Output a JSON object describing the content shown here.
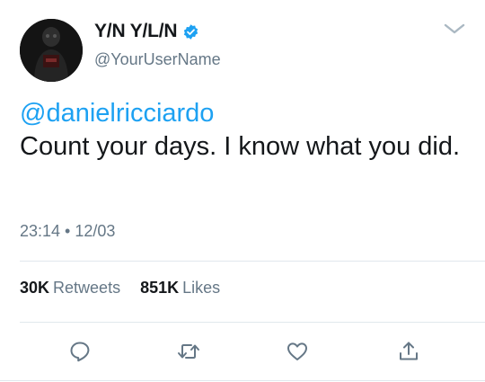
{
  "author": {
    "display_name": "Y/N Y/L/N",
    "username": "@YourUserName",
    "verified": true
  },
  "tweet": {
    "mention": "@danielricciardo",
    "text": "Count your days. I know what you did.",
    "timestamp": "23:14 • 12/03"
  },
  "stats": {
    "retweets_count": "30K",
    "retweets_label": "Retweets",
    "likes_count": "851K",
    "likes_label": "Likes"
  },
  "actions": [
    {
      "name": "reply",
      "icon": "reply-icon"
    },
    {
      "name": "retweet",
      "icon": "retweet-icon"
    },
    {
      "name": "like",
      "icon": "heart-icon"
    },
    {
      "name": "share",
      "icon": "share-icon"
    }
  ],
  "colors": {
    "link": "#1da1f2",
    "secondary_text": "#657786",
    "primary_text": "#14171a",
    "divider": "#e1e8ed",
    "verified_badge": "#1da1f2"
  }
}
